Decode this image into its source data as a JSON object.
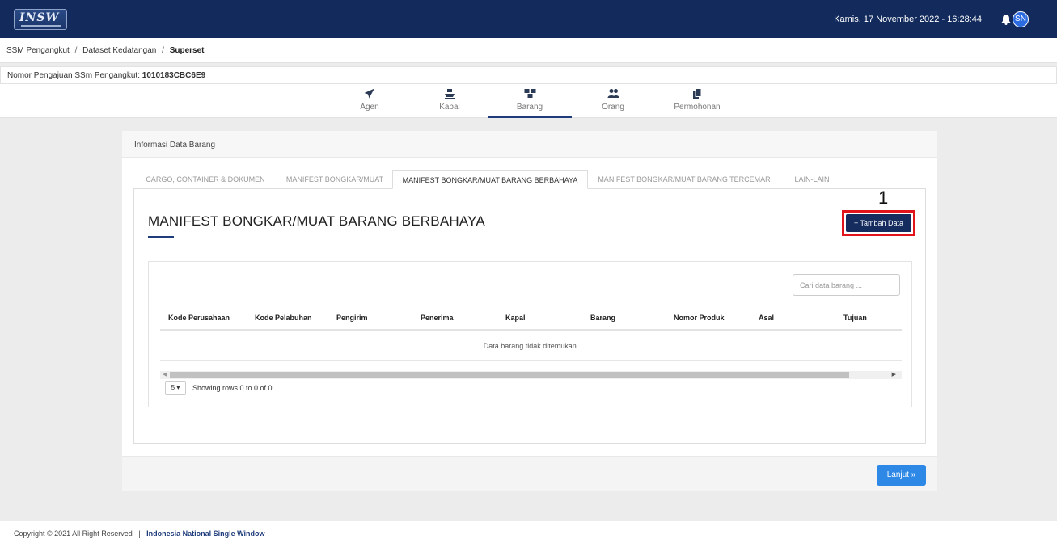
{
  "header": {
    "logo_text": "INSW",
    "datetime": "Kamis, 17 November 2022 - 16:28:44",
    "avatar_initials": "SN",
    "bar_color": "#132b5c"
  },
  "breadcrumb": {
    "items": [
      "SSM Pengangkut",
      "Dataset Kedatangan"
    ],
    "current": "Superset",
    "separator": "/"
  },
  "submission": {
    "label": "Nomor Pengajuan SSm Pengangkut:",
    "number": "1010183CBC6E9"
  },
  "steps": [
    {
      "label": "Agen",
      "icon": "paper-plane-icon",
      "active": false
    },
    {
      "label": "Kapal",
      "icon": "ship-icon",
      "active": false
    },
    {
      "label": "Barang",
      "icon": "boxes-icon",
      "active": true
    },
    {
      "label": "Orang",
      "icon": "users-icon",
      "active": false
    },
    {
      "label": "Permohonan",
      "icon": "documents-icon",
      "active": false
    }
  ],
  "card": {
    "header_title": "Informasi Data Barang",
    "tabs": [
      {
        "label": "CARGO, CONTAINER & DOKUMEN",
        "active": false
      },
      {
        "label": "MANIFEST BONGKAR/MUAT",
        "active": false
      },
      {
        "label": "MANIFEST BONGKAR/MUAT BARANG BERBAHAYA",
        "active": true
      },
      {
        "label": "MANIFEST BONGKAR/MUAT BARANG TERCEMAR",
        "active": false
      },
      {
        "label": "LAIN-LAIN",
        "active": false
      }
    ],
    "section_title": "MANIFEST BONGKAR/MUAT BARANG BERBAHAYA",
    "annotation_number": "1",
    "add_button_label": "+ Tambah Data",
    "search_placeholder": "Cari data barang ...",
    "columns": [
      "Kode Perusahaan",
      "Kode Pelabuhan",
      "Pengirim",
      "Penerima",
      "Kapal",
      "Barang",
      "Nomor Produk",
      "Asal",
      "Tujuan"
    ],
    "empty_message": "Data barang tidak ditemukan.",
    "page_size": "5",
    "pager_info": "Showing rows 0 to 0 of 0",
    "next_button_label": "Lanjut »"
  },
  "footer": {
    "copyright": "Copyright © 2021 All Right Reserved",
    "separator": "|",
    "org": "Indonesia National Single Window"
  },
  "colors": {
    "navy": "#132b5c",
    "accent_blue": "#2e88e6",
    "annotation_red": "#e0151b"
  }
}
